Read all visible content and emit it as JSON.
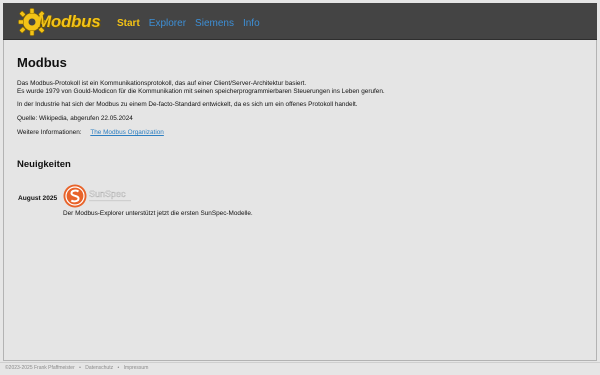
{
  "header": {
    "logo_text": "Modbus",
    "nav": [
      {
        "label": "Start",
        "active": true
      },
      {
        "label": "Explorer",
        "active": false
      },
      {
        "label": "Siemens",
        "active": false
      },
      {
        "label": "Info",
        "active": false
      }
    ]
  },
  "main": {
    "title": "Modbus",
    "intro_line1": "Das Modbus-Protokoll ist ein Kommunikationsprotokoll, das auf einer Client/Server-Architektur basiert.",
    "intro_line2": "Es wurde 1979 von Gould-Modicon für die Kommunikation mit seinen speicherprogrammierbaren Steuerungen ins Leben gerufen.",
    "industry_text": "In der Industrie hat sich der Modbus zu einem De-facto-Standard entwickelt, da es sich um ein offenes Protokoll handelt.",
    "source_text": "Quelle: Wikipedia, abgerufen 22.05.2024",
    "more_info_label": "Weitere Informationen:",
    "more_info_link": "The Modbus Organization"
  },
  "news": {
    "heading": "Neuigkeiten",
    "items": [
      {
        "date": "August 2025",
        "logo_label": "SunSpec",
        "text": "Der Modbus-Explorer unterstützt jetzt die ersten SunSpec-Modelle."
      }
    ]
  },
  "footer": {
    "copyright": "©2023-2025 Frank Pfaffmeister",
    "links": [
      "Datenschutz",
      "Impressum"
    ]
  },
  "colors": {
    "header_bg": "#444444",
    "accent_yellow": "#f4c315",
    "link_blue": "#3d8fd6",
    "sunspec_orange": "#e8632a"
  },
  "icons": {
    "logo": "gear-icon",
    "news_logo": "sunspec-logo"
  }
}
